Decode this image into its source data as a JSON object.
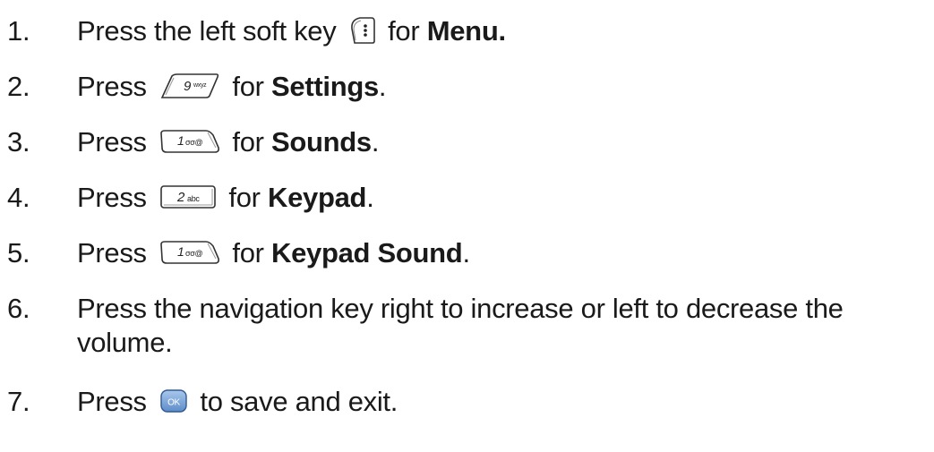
{
  "steps": [
    {
      "number": "1.",
      "prefix": "Press the left soft key",
      "key_icon": "left-soft-key-icon",
      "middle": "for",
      "emphasis": "Menu.",
      "suffix": ""
    },
    {
      "number": "2.",
      "prefix": "Press",
      "key_icon": "key-9-wxyz-icon",
      "key_text": "9",
      "key_sub": "wxyz",
      "middle": "for",
      "emphasis": "Settings",
      "suffix": "."
    },
    {
      "number": "3.",
      "prefix": "Press",
      "key_icon": "key-1-voicemail-icon",
      "key_text": "1",
      "key_sub": "σσ@",
      "middle": "for",
      "emphasis": "Sounds",
      "suffix": "."
    },
    {
      "number": "4.",
      "prefix": "Press",
      "key_icon": "key-2-abc-icon",
      "key_text": "2",
      "key_sub": "abc",
      "middle": "for",
      "emphasis": "Keypad",
      "suffix": "."
    },
    {
      "number": "5.",
      "prefix": "Press",
      "key_icon": "key-1-voicemail-icon",
      "key_text": "1",
      "key_sub": "σσ@",
      "middle": "for",
      "emphasis": "Keypad Sound",
      "suffix": "."
    },
    {
      "number": "6.",
      "text": "Press the navigation key right to increase or left to decrease the volume."
    },
    {
      "number": "7.",
      "prefix": "Press",
      "key_icon": "ok-key-icon",
      "key_text": "OK",
      "suffix": "to save and exit."
    }
  ]
}
